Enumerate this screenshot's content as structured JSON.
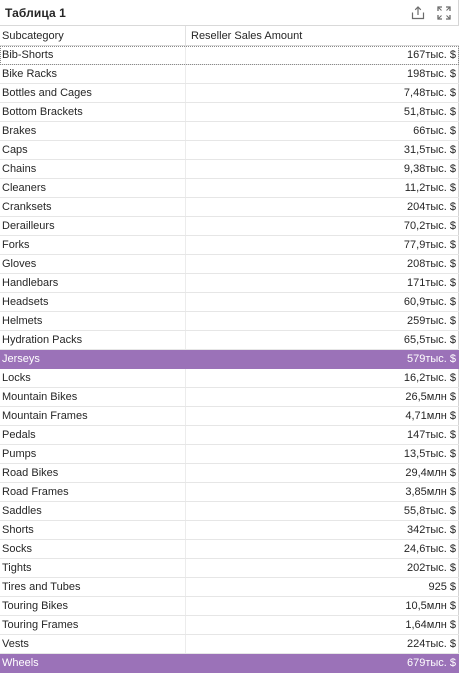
{
  "window": {
    "title": "Таблица 1",
    "export_icon": "share-export-icon",
    "fullscreen_icon": "expand-fullscreen-icon"
  },
  "table": {
    "headers": {
      "subcategory": "Subcategory",
      "amount": "Reseller Sales Amount"
    },
    "rows": [
      {
        "subcategory": "Bib-Shorts",
        "amount": "167тыс. $",
        "selected": false
      },
      {
        "subcategory": "Bike Racks",
        "amount": "198тыс. $",
        "selected": false
      },
      {
        "subcategory": "Bottles and Cages",
        "amount": "7,48тыс. $",
        "selected": false
      },
      {
        "subcategory": "Bottom Brackets",
        "amount": "51,8тыс. $",
        "selected": false
      },
      {
        "subcategory": "Brakes",
        "amount": "66тыс. $",
        "selected": false
      },
      {
        "subcategory": "Caps",
        "amount": "31,5тыс. $",
        "selected": false
      },
      {
        "subcategory": "Chains",
        "amount": "9,38тыс. $",
        "selected": false
      },
      {
        "subcategory": "Cleaners",
        "amount": "11,2тыс. $",
        "selected": false
      },
      {
        "subcategory": "Cranksets",
        "amount": "204тыс. $",
        "selected": false
      },
      {
        "subcategory": "Derailleurs",
        "amount": "70,2тыс. $",
        "selected": false
      },
      {
        "subcategory": "Forks",
        "amount": "77,9тыс. $",
        "selected": false
      },
      {
        "subcategory": "Gloves",
        "amount": "208тыс. $",
        "selected": false
      },
      {
        "subcategory": "Handlebars",
        "amount": "171тыс. $",
        "selected": false
      },
      {
        "subcategory": "Headsets",
        "amount": "60,9тыс. $",
        "selected": false
      },
      {
        "subcategory": "Helmets",
        "amount": "259тыс. $",
        "selected": false
      },
      {
        "subcategory": "Hydration Packs",
        "amount": "65,5тыс. $",
        "selected": false
      },
      {
        "subcategory": "Jerseys",
        "amount": "579тыс. $",
        "selected": true
      },
      {
        "subcategory": "Locks",
        "amount": "16,2тыс. $",
        "selected": false
      },
      {
        "subcategory": "Mountain Bikes",
        "amount": "26,5млн $",
        "selected": false
      },
      {
        "subcategory": "Mountain Frames",
        "amount": "4,71млн $",
        "selected": false
      },
      {
        "subcategory": "Pedals",
        "amount": "147тыс. $",
        "selected": false
      },
      {
        "subcategory": "Pumps",
        "amount": "13,5тыс. $",
        "selected": false
      },
      {
        "subcategory": "Road Bikes",
        "amount": "29,4млн $",
        "selected": false
      },
      {
        "subcategory": "Road Frames",
        "amount": "3,85млн $",
        "selected": false
      },
      {
        "subcategory": "Saddles",
        "amount": "55,8тыс. $",
        "selected": false
      },
      {
        "subcategory": "Shorts",
        "amount": "342тыс. $",
        "selected": false
      },
      {
        "subcategory": "Socks",
        "amount": "24,6тыс. $",
        "selected": false
      },
      {
        "subcategory": "Tights",
        "amount": "202тыс. $",
        "selected": false
      },
      {
        "subcategory": "Tires and Tubes",
        "amount": "925 $",
        "selected": false
      },
      {
        "subcategory": "Touring Bikes",
        "amount": "10,5млн $",
        "selected": false
      },
      {
        "subcategory": "Touring Frames",
        "amount": "1,64млн $",
        "selected": false
      },
      {
        "subcategory": "Vests",
        "amount": "224тыс. $",
        "selected": false
      },
      {
        "subcategory": "Wheels",
        "amount": "679тыс. $",
        "selected": true
      }
    ]
  },
  "colors": {
    "selection": "#9b72b8",
    "selection_text": "#ffffff",
    "grid_line": "#e6e6e6"
  }
}
